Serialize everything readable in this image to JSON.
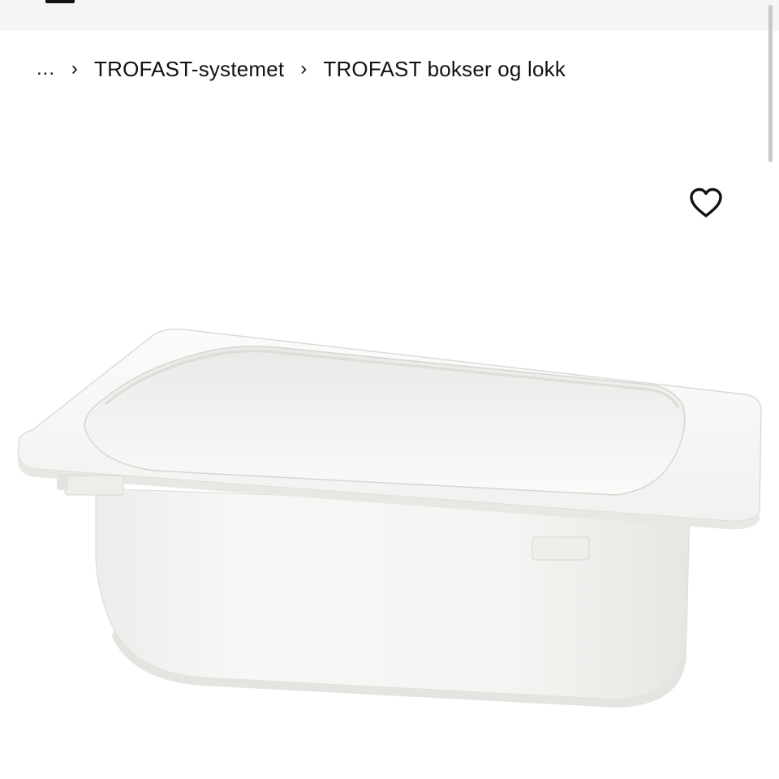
{
  "breadcrumb": {
    "ellipsis": "...",
    "separator": "›",
    "items": [
      {
        "label": "TROFAST-systemet"
      },
      {
        "label": "TROFAST bokser og lokk"
      }
    ]
  },
  "favorite": {
    "icon": "heart-outline-icon"
  },
  "product_image": {
    "alt": "TROFAST boks hvit",
    "color": "#ffffff"
  },
  "colors": {
    "text": "#111111",
    "top_bar": "#f5f5f5",
    "scrollbar_thumb": "#c9c9c9"
  }
}
